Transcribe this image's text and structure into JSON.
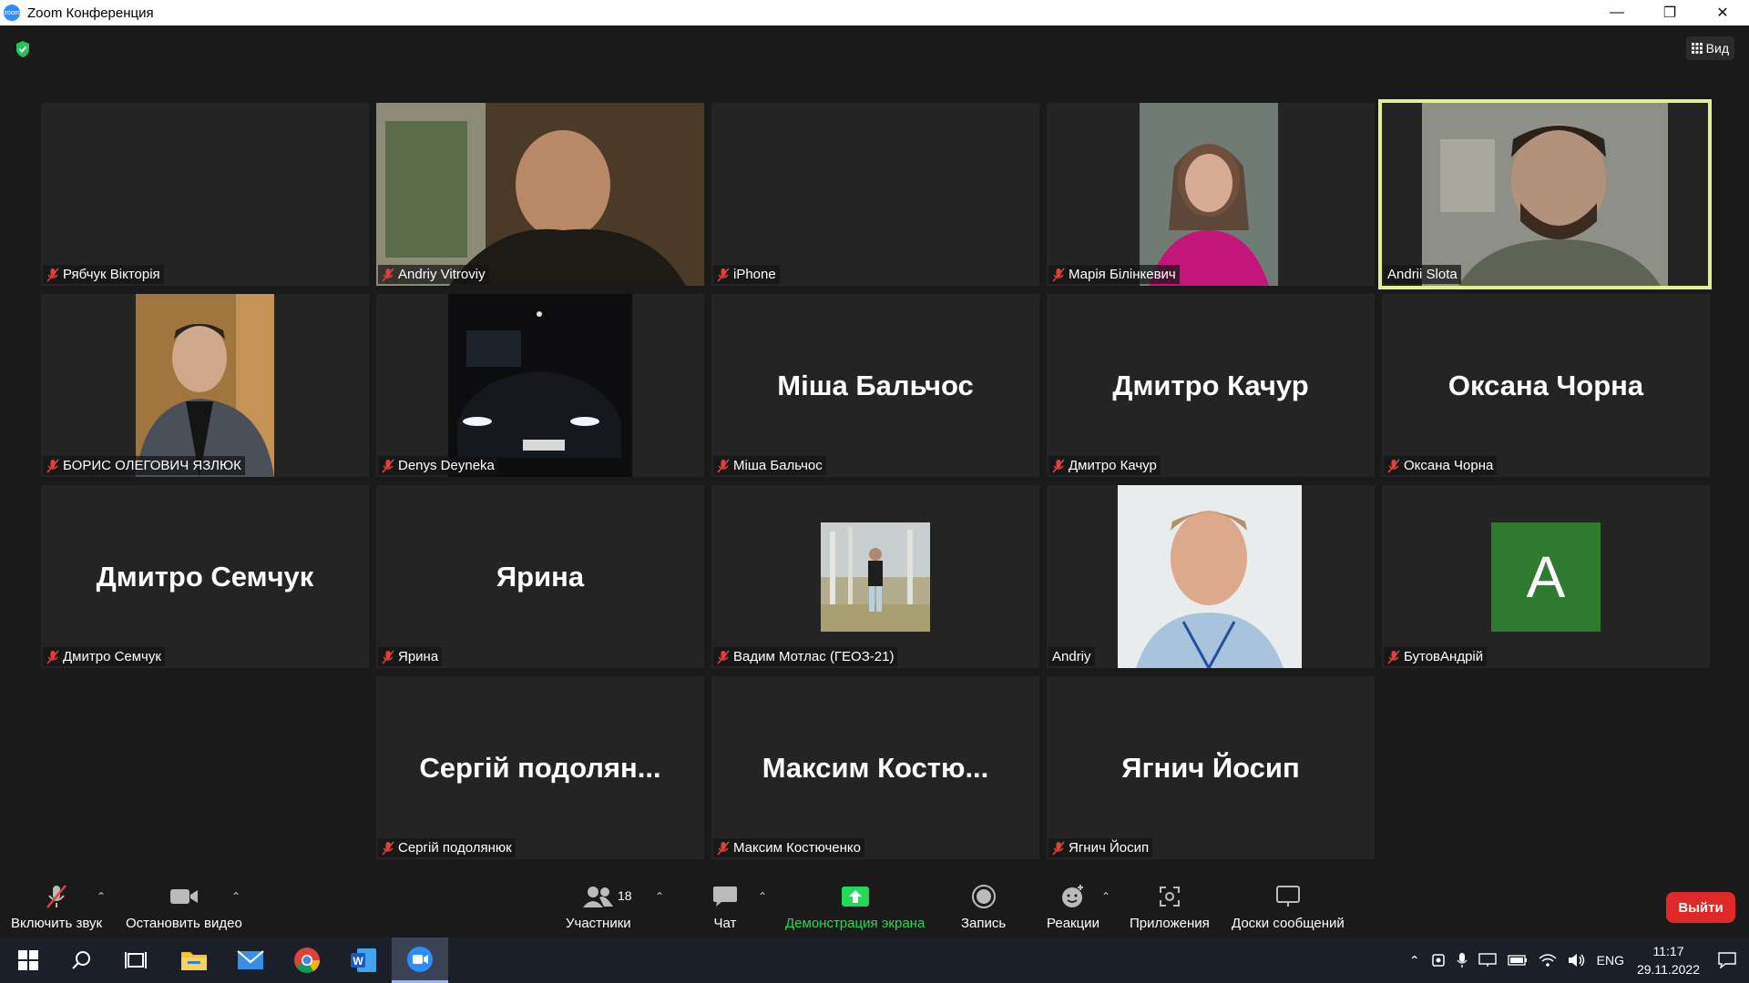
{
  "window": {
    "title": "Zoom Конференция",
    "minimize": "—",
    "restore": "❐",
    "close": "✕"
  },
  "view_button": {
    "label": "Вид"
  },
  "participants": [
    {
      "name": "Рябчук Вікторія",
      "muted": true
    },
    {
      "name": "Andriy Vitroviy",
      "muted": true
    },
    {
      "name": "iPhone",
      "muted": true
    },
    {
      "name": "Марія Білінкевич",
      "muted": true
    },
    {
      "name": "Andrii Slota",
      "muted": false
    },
    {
      "name": "БОРИС ОЛЕГОВИЧ ЯЗЛЮК",
      "muted": true
    },
    {
      "name": "Denys Deyneka",
      "muted": true
    },
    {
      "name": "Міша Бальчос",
      "display": "Міша Бальчос",
      "muted": true
    },
    {
      "name": "Дмитро Качур",
      "display": "Дмитро Качур",
      "muted": true
    },
    {
      "name": "Оксана Чорна",
      "display": "Оксана Чорна",
      "muted": true
    },
    {
      "name": "Дмитро Семчук",
      "display": "Дмитро Семчук",
      "muted": true
    },
    {
      "name": "Ярина",
      "display": "Ярина",
      "muted": true
    },
    {
      "name": "Вадим Мотлас (ГЕОЗ-21)",
      "muted": true
    },
    {
      "name": "Andriy",
      "muted": false
    },
    {
      "name": "БутовАндрій",
      "avatar_letter": "A",
      "muted": true
    },
    {
      "name": "Сергій подолянюк",
      "display": "Сергій подолян...",
      "muted": true
    },
    {
      "name": "Максим Костюченко",
      "display": "Максим Костю...",
      "muted": true
    },
    {
      "name": "Ягнич Йосип",
      "display": "Ягнич Йосип",
      "muted": true
    }
  ],
  "toolbar": {
    "unmute": "Включить звук",
    "stop_video": "Остановить видео",
    "participants": "Участники",
    "participants_count": "18",
    "chat": "Чат",
    "share": "Демонстрация экрана",
    "record": "Запись",
    "reactions": "Реакции",
    "apps": "Приложения",
    "whiteboards": "Доски сообщений",
    "leave": "Выйти"
  },
  "colors": {
    "share_green": "#23d959",
    "leave_red": "#e02828",
    "active_border": "#e3f090",
    "tile_bg": "#242424"
  },
  "taskbar": {
    "lang": "ENG",
    "time": "11:17",
    "date": "29.11.2022"
  }
}
